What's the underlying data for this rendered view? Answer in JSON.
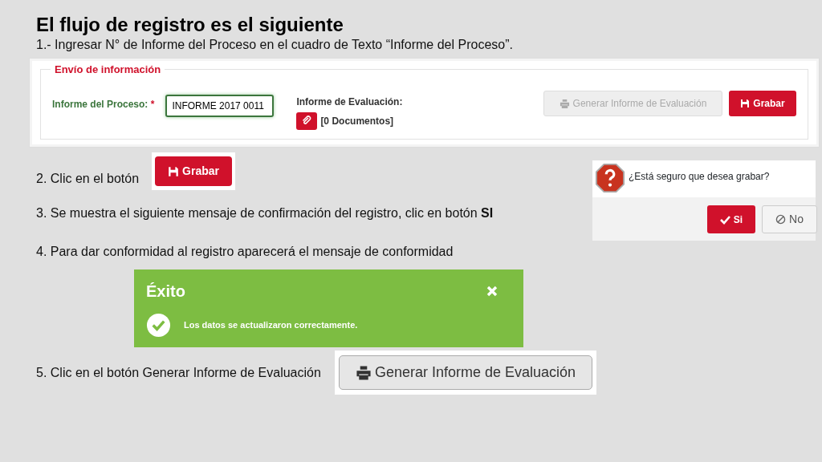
{
  "title": "El flujo de registro es el siguiente",
  "steps": [
    {
      "text": "1.- Ingresar N° de Informe del Proceso en el cuadro de Texto “Informe del Proceso”."
    },
    {
      "text": "2. Clic en el botón"
    },
    {
      "text": "3. Se muestra el siguiente mensaje de confirmación del registro, clic en botón **SI**"
    },
    {
      "text": "4. Para dar conformidad al registro aparecerá el mensaje de conformidad"
    },
    {
      "text": "5. Clic en el botón Generar Informe de Evaluación"
    }
  ],
  "form_panel": {
    "legend": "Envío de información",
    "field_label": "Informe del Proceso:",
    "required_mark": "*",
    "field_value": "INFORME 2017 0011",
    "evaluation_label": "Informe de Evaluación:",
    "attachment_count": "[0 Documentos]",
    "buttons": [
      {
        "label": "Generar Informe de Evaluación",
        "kind": "print",
        "disabled": true
      },
      {
        "label": "Grabar",
        "kind": "save",
        "disabled": false
      }
    ]
  },
  "step2_button": {
    "label": "Grabar"
  },
  "confirm_dialog": {
    "message": "¿Está seguro que desea grabar?",
    "buttons": [
      {
        "label": "Si",
        "kind": "confirm"
      },
      {
        "label": "No",
        "kind": "cancel"
      }
    ]
  },
  "success_alert": {
    "title": "Éxito",
    "message": "Los datos se actualizaron correctamente."
  },
  "step5_button": {
    "label": "Generar Informe de Evaluación"
  }
}
